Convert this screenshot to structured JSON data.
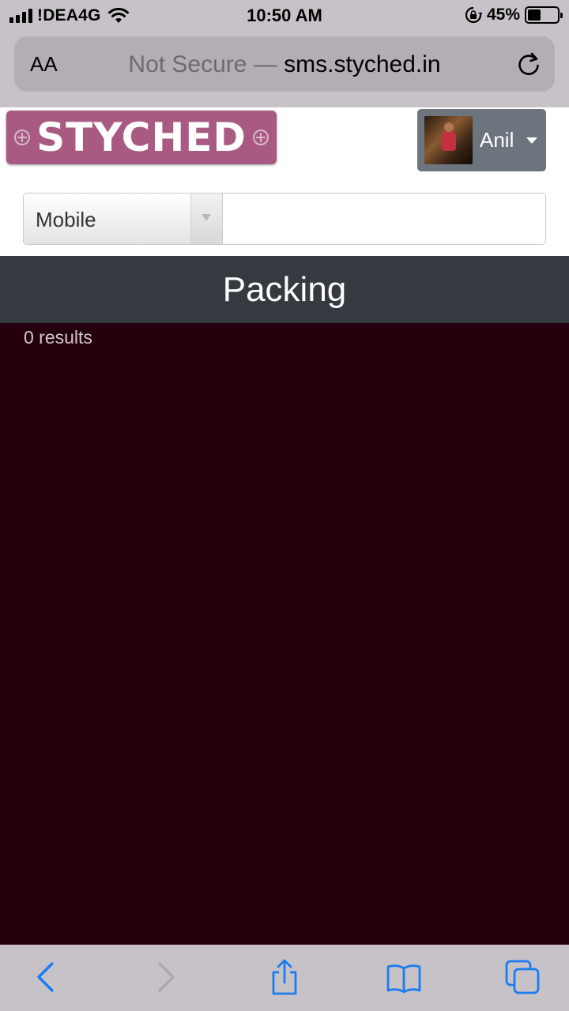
{
  "status_bar": {
    "carrier": "!DEA4G",
    "time": "10:50 AM",
    "battery_percent": "45%",
    "battery_level": 0.45,
    "icons": [
      "signal-icon",
      "wifi-icon",
      "rotation-lock-icon",
      "battery-icon"
    ]
  },
  "browser": {
    "text_size_label": "AA",
    "url_security": "Not Secure —",
    "url_host": "sms.styched.in",
    "icons": [
      "reload-icon"
    ]
  },
  "header": {
    "logo_text": "STYCHED",
    "logo_color": "#a85a82",
    "user_name": "Anil",
    "user_button_color": "#6c757d"
  },
  "search": {
    "field_selected": "Mobile",
    "query": ""
  },
  "page": {
    "title": "Packing",
    "results_text": "0 results",
    "title_bar_color": "#343a40",
    "background_color": "#24000f"
  },
  "toolbar": {
    "icons": [
      "back-icon",
      "forward-icon",
      "share-icon",
      "bookmarks-icon",
      "tabs-icon"
    ],
    "accent_color": "#1a7cf0"
  }
}
